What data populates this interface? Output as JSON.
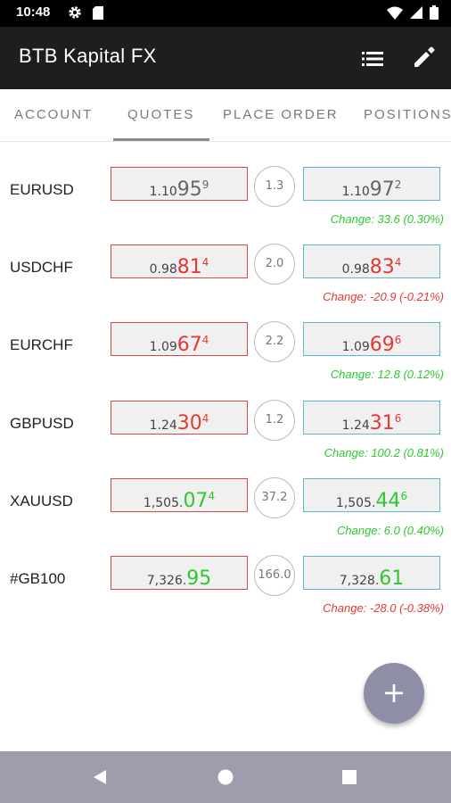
{
  "status": {
    "time": "10:48"
  },
  "app": {
    "title": "BTB Kapital FX"
  },
  "tabs": [
    "ACCOUNT",
    "QUOTES",
    "PLACE ORDER",
    "POSITIONS"
  ],
  "quotes": [
    {
      "symbol": "EURUSD",
      "bid": {
        "small": "1.10",
        "big": "95",
        "sup": "9",
        "color": "grey"
      },
      "spread": "1.3",
      "ask": {
        "small": "1.10",
        "big": "97",
        "sup": "2",
        "color": "grey"
      },
      "change": "Change: 33.6 (0.30%)",
      "direction": "up"
    },
    {
      "symbol": "USDCHF",
      "bid": {
        "small": "0.98",
        "big": "81",
        "sup": "4",
        "color": "red"
      },
      "spread": "2.0",
      "ask": {
        "small": "0.98",
        "big": "83",
        "sup": "4",
        "color": "red"
      },
      "change": "Change: -20.9 (-0.21%)",
      "direction": "down"
    },
    {
      "symbol": "EURCHF",
      "bid": {
        "small": "1.09",
        "big": "67",
        "sup": "4",
        "color": "red"
      },
      "spread": "2.2",
      "ask": {
        "small": "1.09",
        "big": "69",
        "sup": "6",
        "color": "red"
      },
      "change": "Change: 12.8 (0.12%)",
      "direction": "up"
    },
    {
      "symbol": "GBPUSD",
      "bid": {
        "small": "1.24",
        "big": "30",
        "sup": "4",
        "color": "red"
      },
      "spread": "1.2",
      "ask": {
        "small": "1.24",
        "big": "31",
        "sup": "6",
        "color": "red"
      },
      "change": "Change: 100.2 (0.81%)",
      "direction": "up"
    },
    {
      "symbol": "XAUUSD",
      "bid": {
        "small": "1,505.",
        "big": "07",
        "sup": "4",
        "color": "green"
      },
      "spread": "37.2",
      "ask": {
        "small": "1,505.",
        "big": "44",
        "sup": "6",
        "color": "green"
      },
      "change": "Change: 6.0 (0.40%)",
      "direction": "up"
    },
    {
      "symbol": "#GB100",
      "bid": {
        "small": "7,326.",
        "big": "95",
        "sup": "",
        "color": "green"
      },
      "spread": "166.0",
      "ask": {
        "small": "7,328.",
        "big": "61",
        "sup": "",
        "color": "green"
      },
      "change": "Change: -28.0 (-0.38%)",
      "direction": "down"
    }
  ],
  "fab": {
    "icon": "plus-icon",
    "label": "+"
  },
  "colors": {
    "bid_border": "#d94848",
    "ask_border": "#5fb8cf",
    "up": "#2fc82f",
    "down": "#e53935",
    "appbar": "#1e1e1e"
  }
}
